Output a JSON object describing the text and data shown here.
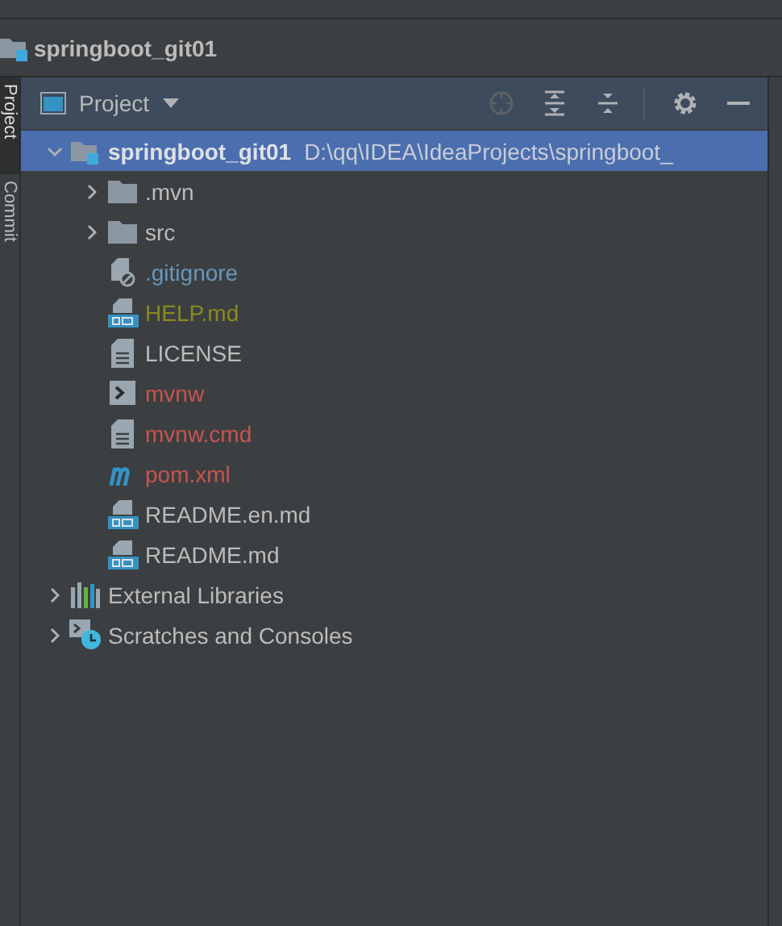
{
  "breadcrumb": {
    "title": "springboot_git01"
  },
  "side_tabs": [
    {
      "label": "Project",
      "selected": true
    },
    {
      "label": "Commit",
      "selected": false
    }
  ],
  "panel": {
    "title": "Project"
  },
  "tree": [
    {
      "label": "springboot_git01",
      "path": "D:\\qq\\IDEA\\IdeaProjects\\springboot_",
      "kind": "module",
      "expanded": true,
      "selected": true,
      "children": [
        {
          "label": ".mvn",
          "kind": "folder",
          "expanded": false,
          "selected": false,
          "color": "#bbbbbb"
        },
        {
          "label": "src",
          "kind": "folder",
          "expanded": false,
          "selected": false,
          "color": "#bbbbbb"
        },
        {
          "label": ".gitignore",
          "kind": "ignore",
          "selected": false,
          "color": "#6897bb"
        },
        {
          "label": "HELP.md",
          "kind": "markdown",
          "selected": false,
          "color": "#8a8a1f"
        },
        {
          "label": "LICENSE",
          "kind": "text",
          "selected": false,
          "color": "#bbbbbb"
        },
        {
          "label": "mvnw",
          "kind": "script",
          "selected": false,
          "color": "#c75450"
        },
        {
          "label": "mvnw.cmd",
          "kind": "text",
          "selected": false,
          "color": "#c75450"
        },
        {
          "label": "pom.xml",
          "kind": "maven",
          "selected": false,
          "color": "#c75450"
        },
        {
          "label": "README.en.md",
          "kind": "markdown",
          "selected": false,
          "color": "#bbbbbb"
        },
        {
          "label": "README.md",
          "kind": "markdown",
          "selected": false,
          "color": "#bbbbbb"
        }
      ]
    },
    {
      "label": "External Libraries",
      "kind": "libraries",
      "expanded": false,
      "selected": false
    },
    {
      "label": "Scratches and Consoles",
      "kind": "scratches",
      "expanded": false,
      "selected": false
    }
  ]
}
